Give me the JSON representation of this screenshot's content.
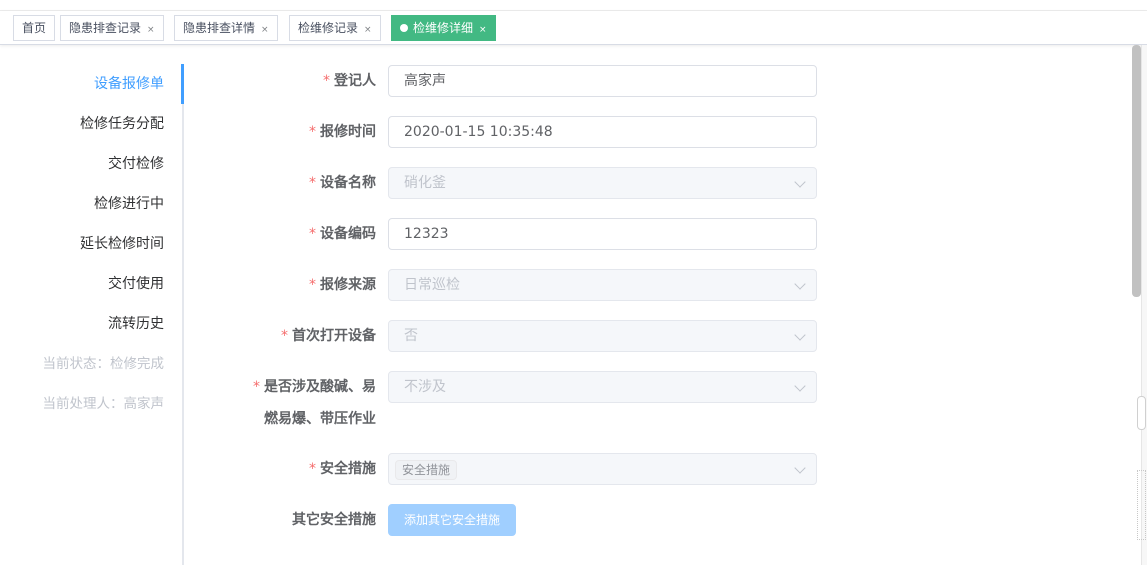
{
  "tabs": [
    {
      "label": "首页",
      "closable": false
    },
    {
      "label": "隐患排查记录",
      "closable": true
    },
    {
      "label": "隐患排查详情",
      "closable": true
    },
    {
      "label": "检维修记录",
      "closable": true
    },
    {
      "label": "检维修详细",
      "closable": true,
      "active": true
    }
  ],
  "tab_close_glyph": "×",
  "sidebar": {
    "items": [
      {
        "label": "设备报修单",
        "active": true
      },
      {
        "label": "检修任务分配"
      },
      {
        "label": "交付检修"
      },
      {
        "label": "检修进行中"
      },
      {
        "label": "延长检修时间"
      },
      {
        "label": "交付使用"
      },
      {
        "label": "流转历史"
      }
    ],
    "status": "当前状态：检修完成",
    "handler": "当前处理人：高家声"
  },
  "form": {
    "registrant": {
      "label": "登记人",
      "value": "高家声"
    },
    "report_time": {
      "label": "报修时间",
      "value": "2020-01-15 10:35:48"
    },
    "device_name": {
      "label": "设备名称",
      "value": "硝化釜"
    },
    "device_code": {
      "label": "设备编码",
      "value": "12323"
    },
    "report_source": {
      "label": "报修来源",
      "value": "日常巡检"
    },
    "first_open": {
      "label": "首次打开设备",
      "value": "否"
    },
    "hazard_work": {
      "label_line1": "是否涉及酸碱、易",
      "label_line2": "燃易爆、带压作业",
      "value": "不涉及"
    },
    "safety_measures": {
      "label": "安全措施",
      "tag": "安全措施"
    },
    "other_measures": {
      "label": "其它安全措施",
      "button": "添加其它安全措施"
    },
    "required_mark": "*"
  },
  "colors": {
    "accent": "#409eff",
    "active_tab": "#42b983",
    "required": "#f56c6c",
    "button_disabled": "#a0cfff"
  }
}
